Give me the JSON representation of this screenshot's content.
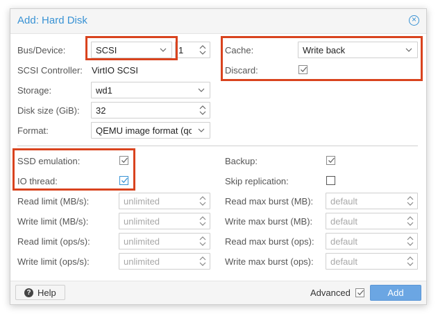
{
  "dialog": {
    "title": "Add: Hard Disk",
    "close_icon": "close-circle-icon"
  },
  "left": {
    "bus_device_label": "Bus/Device:",
    "bus_value": "SCSI",
    "device_number": "1",
    "scsi_controller_label": "SCSI Controller:",
    "scsi_controller_value": "VirtIO SCSI",
    "storage_label": "Storage:",
    "storage_value": "wd1",
    "disk_size_label": "Disk size (GiB):",
    "disk_size_value": "32",
    "format_label": "Format:",
    "format_value": "QEMU image format (qc"
  },
  "right": {
    "cache_label": "Cache:",
    "cache_value": "Write back",
    "discard_label": "Discard:",
    "discard_checked": true
  },
  "advanced_left": {
    "ssd_label": "SSD emulation:",
    "ssd_checked": true,
    "io_thread_label": "IO thread:",
    "io_thread_checked": true,
    "read_limit_mb_label": "Read limit (MB/s):",
    "read_limit_mb_placeholder": "unlimited",
    "write_limit_mb_label": "Write limit (MB/s):",
    "write_limit_mb_placeholder": "unlimited",
    "read_limit_ops_label": "Read limit (ops/s):",
    "read_limit_ops_placeholder": "unlimited",
    "write_limit_ops_label": "Write limit (ops/s):",
    "write_limit_ops_placeholder": "unlimited"
  },
  "advanced_right": {
    "backup_label": "Backup:",
    "backup_checked": true,
    "skip_replication_label": "Skip replication:",
    "skip_replication_checked": false,
    "read_burst_mb_label": "Read max burst (MB):",
    "read_burst_mb_placeholder": "default",
    "write_burst_mb_label": "Write max burst (MB):",
    "write_burst_mb_placeholder": "default",
    "read_burst_ops_label": "Read max burst (ops):",
    "read_burst_ops_placeholder": "default",
    "write_burst_ops_label": "Write max burst (ops):",
    "write_burst_ops_placeholder": "default"
  },
  "footer": {
    "help_label": "Help",
    "advanced_label": "Advanced",
    "advanced_checked": true,
    "add_label": "Add"
  },
  "colors": {
    "accent": "#3892d4",
    "highlight": "#d9431e",
    "add_button": "#6ba6e3"
  }
}
